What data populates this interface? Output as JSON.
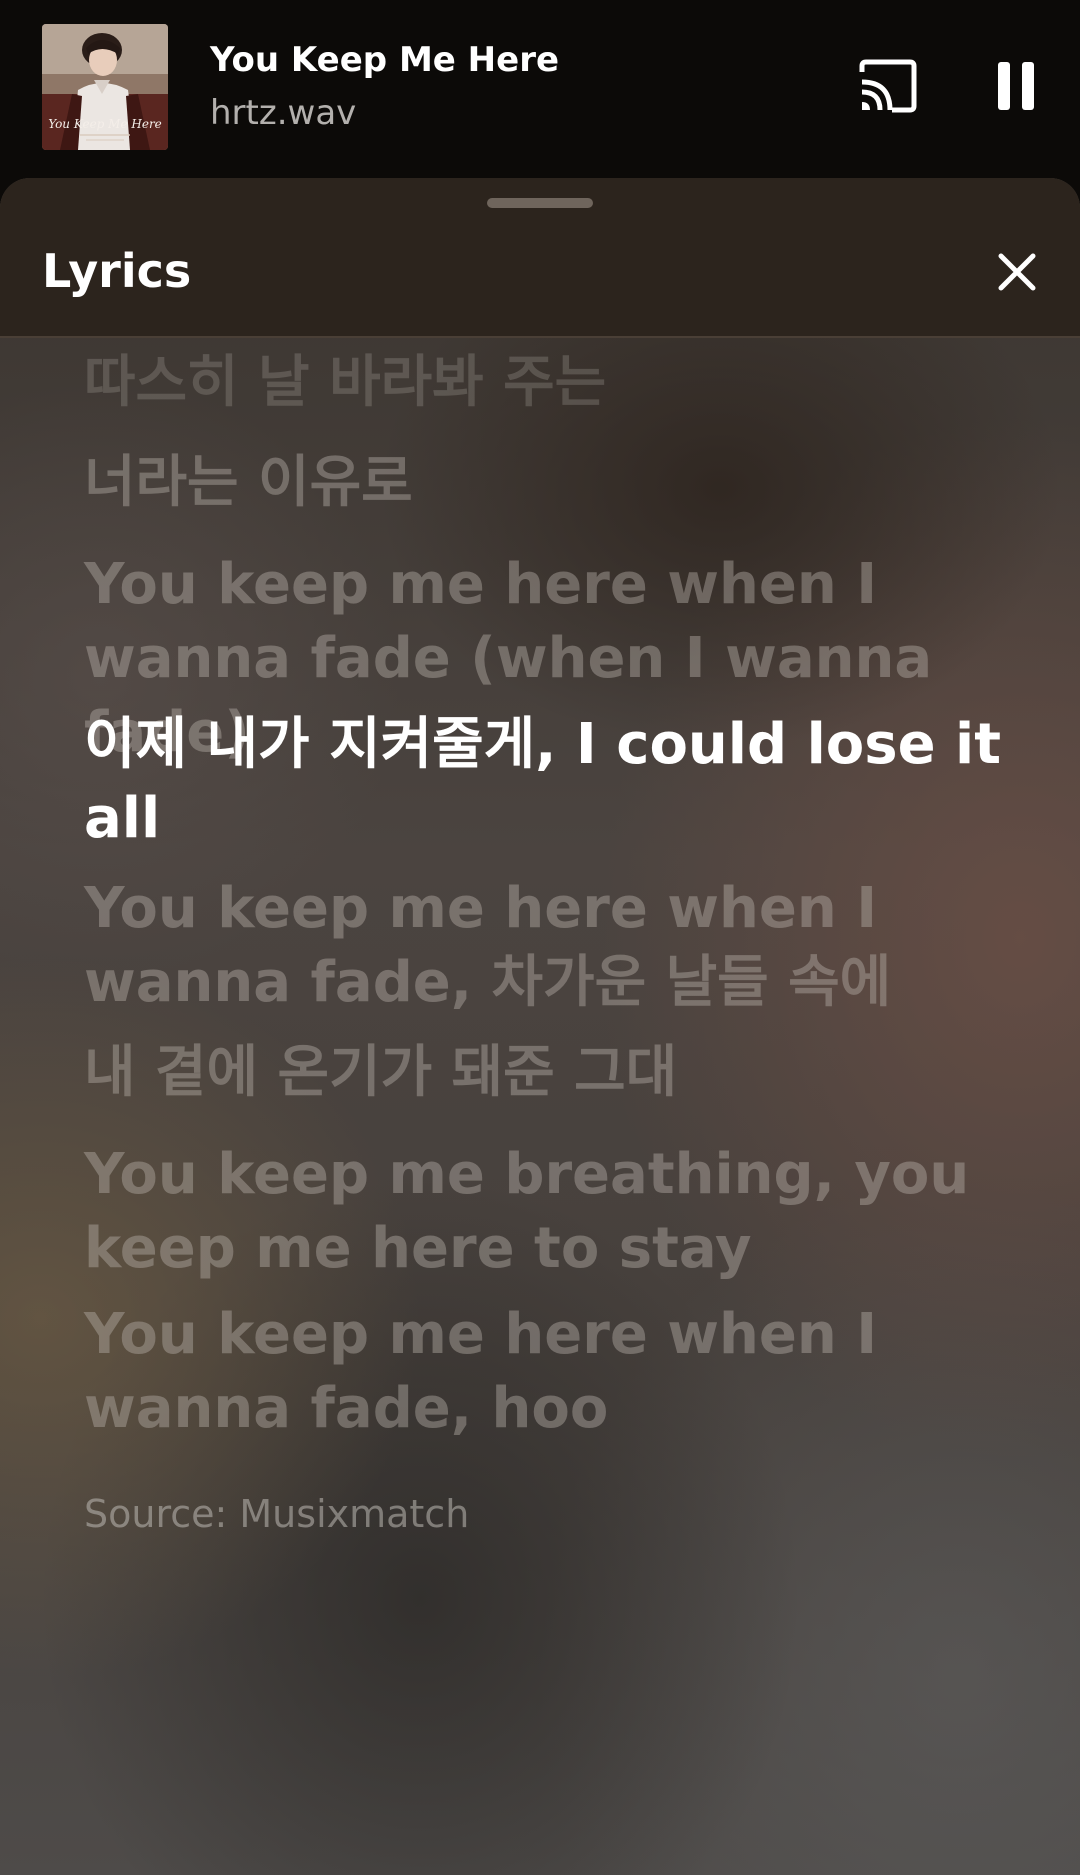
{
  "player": {
    "album_art_text": "You Keep Me Here",
    "track_title": "You Keep Me Here",
    "artist": "hrtz.wav",
    "cast_icon": "cast-icon",
    "pause_icon": "pause-icon"
  },
  "sheet": {
    "title": "Lyrics",
    "close_icon": "close-icon"
  },
  "lyrics": {
    "lines": [
      "따스히 날 바라봐 주는",
      "너라는 이유로",
      "You keep me here when I wanna fade (when I wanna fade)",
      "이제 내가 지켜줄게, I could lose it all",
      "You keep me here when I wanna fade, 차가운 날들 속에",
      "내 곁에 온기가 돼준 그대",
      "You keep me breathing, you keep me here to stay",
      "You keep me here when I wanna fade, hoo"
    ],
    "active_index": 3,
    "source": "Source: Musixmatch"
  }
}
